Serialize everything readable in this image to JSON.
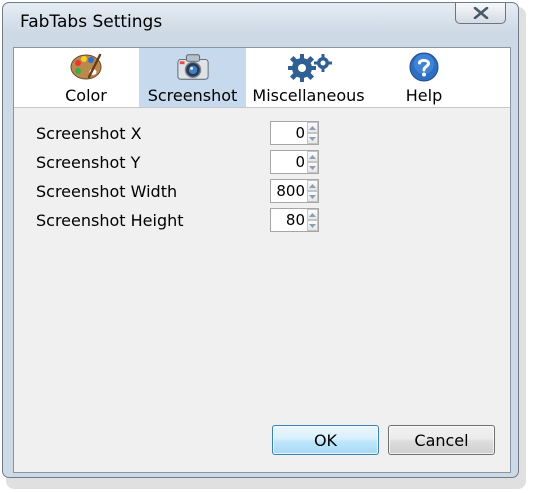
{
  "window": {
    "title": "FabTabs Settings"
  },
  "tabs": [
    {
      "label": "Color",
      "icon": "palette-icon",
      "active": false
    },
    {
      "label": "Screenshot",
      "icon": "camera-icon",
      "active": true
    },
    {
      "label": "Miscellaneous",
      "icon": "gears-icon",
      "active": false
    },
    {
      "label": "Help",
      "icon": "help-icon",
      "active": false
    }
  ],
  "fields": [
    {
      "label": "Screenshot X",
      "value": "0"
    },
    {
      "label": "Screenshot Y",
      "value": "0"
    },
    {
      "label": "Screenshot Width",
      "value": "800"
    },
    {
      "label": "Screenshot Height",
      "value": "80"
    }
  ],
  "buttons": {
    "ok": "OK",
    "cancel": "Cancel"
  },
  "colors": {
    "active_tab": "#c7d9ed",
    "panel": "#f0f0f0",
    "close_glyph": "#4a5868"
  }
}
